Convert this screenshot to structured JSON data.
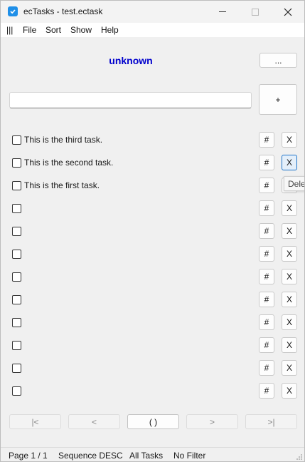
{
  "window": {
    "title": "ecTasks - test.ectask",
    "accent": "#1f8fe8"
  },
  "menu": {
    "handle": "|||",
    "items": [
      "File",
      "Sort",
      "Show",
      "Help"
    ]
  },
  "header": {
    "title": "unknown",
    "title_color": "#0000cd",
    "more_label": "...",
    "add_label": "+",
    "input_value": "",
    "input_placeholder": ""
  },
  "rows": [
    {
      "checked": false,
      "text": "This is the third task.",
      "hash": "#",
      "del": "X"
    },
    {
      "checked": false,
      "text": "This is the second task.",
      "hash": "#",
      "del": "X"
    },
    {
      "checked": false,
      "text": "This is the first task.",
      "hash": "#",
      "del": "X"
    },
    {
      "checked": false,
      "text": "",
      "hash": "#",
      "del": "X"
    },
    {
      "checked": false,
      "text": "",
      "hash": "#",
      "del": "X"
    },
    {
      "checked": false,
      "text": "",
      "hash": "#",
      "del": "X"
    },
    {
      "checked": false,
      "text": "",
      "hash": "#",
      "del": "X"
    },
    {
      "checked": false,
      "text": "",
      "hash": "#",
      "del": "X"
    },
    {
      "checked": false,
      "text": "",
      "hash": "#",
      "del": "X"
    },
    {
      "checked": false,
      "text": "",
      "hash": "#",
      "del": "X"
    },
    {
      "checked": false,
      "text": "",
      "hash": "#",
      "del": "X"
    },
    {
      "checked": false,
      "text": "",
      "hash": "#",
      "del": "X"
    }
  ],
  "tooltip": "Delet",
  "pager": {
    "first": "|<",
    "prev": "<",
    "center": "(  )",
    "next": ">",
    "last": ">|"
  },
  "status": {
    "page": "Page 1 / 1",
    "sort": "Sequence DESC",
    "show": "All Tasks",
    "filter": "No Filter"
  }
}
